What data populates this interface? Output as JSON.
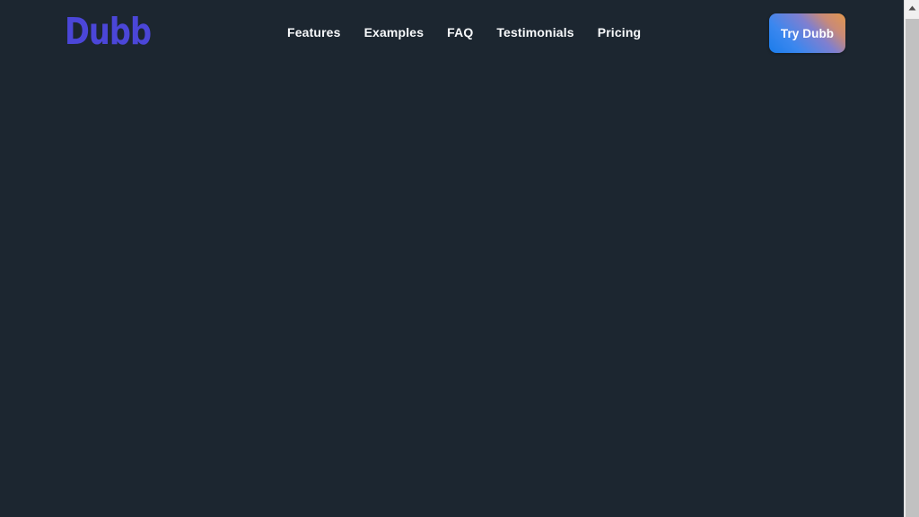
{
  "theme": {
    "page_background": "#1c2630",
    "logo_color": "#4b46d8",
    "nav_text_color": "#f7f9fb",
    "cta_gradient_start": "#1a7ceb",
    "cta_gradient_end": "#e2974c",
    "cta_text_color": "#ffffff",
    "scrollbar_track": "#f0f0f0",
    "scrollbar_thumb": "#c1c1c1"
  },
  "header": {
    "logo_text": "Dubb",
    "nav": [
      {
        "label": "Features"
      },
      {
        "label": "Examples"
      },
      {
        "label": "FAQ"
      },
      {
        "label": "Testimonials"
      },
      {
        "label": "Pricing"
      }
    ],
    "cta": {
      "label": "Try Dubb"
    }
  },
  "scrollbar": {
    "up_arrow_icon": "triangle-up-icon",
    "thumb_label": "vertical-scroll-thumb"
  }
}
